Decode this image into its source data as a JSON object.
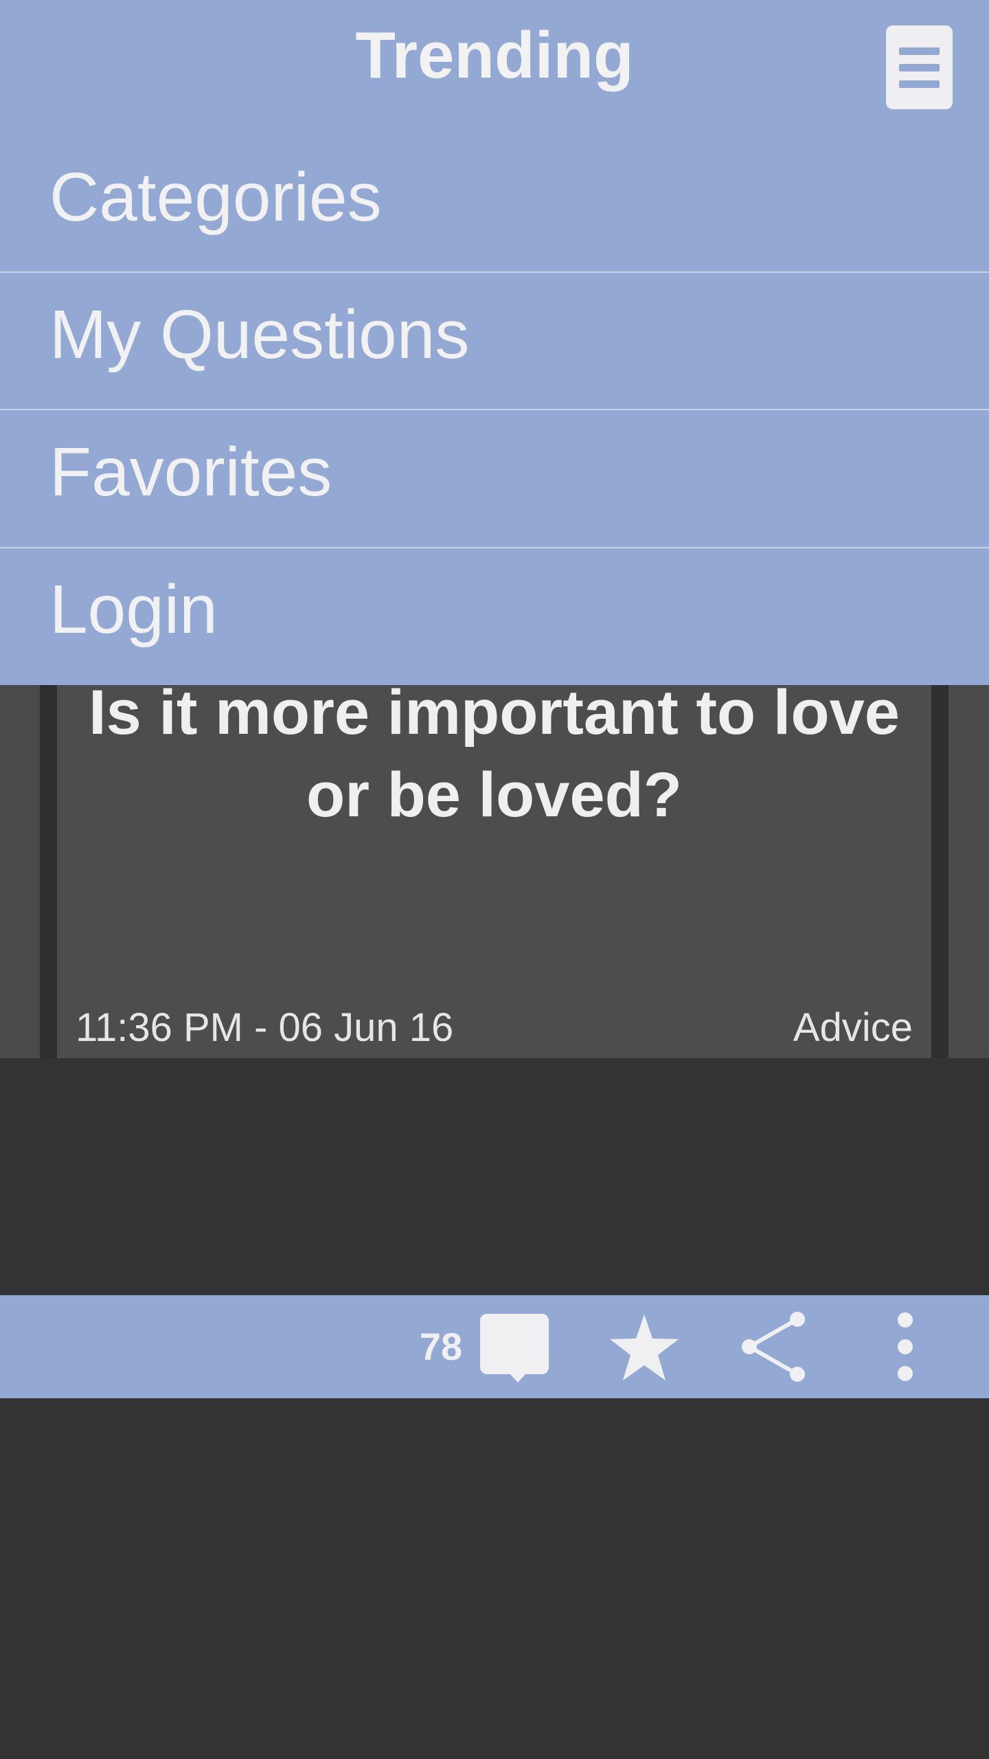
{
  "header": {
    "title": "Trending",
    "menu_icon": "hamburger-menu-icon"
  },
  "menu": {
    "items": [
      {
        "label": "Categories"
      },
      {
        "label": "My Questions"
      },
      {
        "label": "Favorites"
      },
      {
        "label": "Login"
      }
    ]
  },
  "question_card": {
    "question": "Is it more important to love\nor be loved?",
    "timestamp": "11:36 PM - 06 Jun 16",
    "category": "Advice"
  },
  "action_bar": {
    "comment_count": "78",
    "icons": [
      "comment-icon",
      "star-icon",
      "share-icon",
      "more-vertical-icon"
    ]
  },
  "colors": {
    "accent": "#93a8d2",
    "background": "#333333",
    "card": "#4d4d4d",
    "text_light": "#f0f0f0"
  }
}
